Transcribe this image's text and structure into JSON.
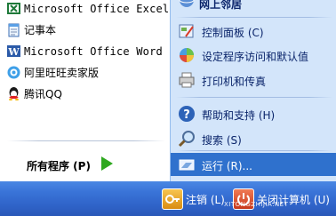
{
  "left_items": [
    {
      "label": "Microsoft Office Excel...",
      "icon": "excel-icon"
    },
    {
      "label": "记事本",
      "icon": "notepad-icon"
    },
    {
      "label": "Microsoft Office Word ...",
      "icon": "word-icon"
    },
    {
      "label": "阿里旺旺卖家版",
      "icon": "aliwangwang-icon"
    },
    {
      "label": "腾讯QQ",
      "icon": "qq-icon"
    }
  ],
  "all_programs": {
    "label": "所有程序 (P)"
  },
  "right_top_partial": "网上邻居",
  "right_items": [
    {
      "label": "控制面板 (C)",
      "icon": "control-panel-icon"
    },
    {
      "label": "设定程序访问和默认值",
      "icon": "program-access-icon"
    },
    {
      "label": "打印机和传真",
      "icon": "printer-icon"
    },
    {
      "label": "帮助和支持 (H)",
      "icon": "help-icon"
    },
    {
      "label": "搜索 (S)",
      "icon": "search-icon"
    },
    {
      "label": "运行 (R)...",
      "icon": "run-icon"
    }
  ],
  "bottom": {
    "logoff": "注销 (L)",
    "shutdown": "关闭计算机 (U)",
    "watermark": "XITONGZHIJIA.NET"
  },
  "colors": {
    "right_pane_bg": "#d3e5fa",
    "selection": "#2f71cd",
    "bottom_bar": "#3a74d8"
  }
}
